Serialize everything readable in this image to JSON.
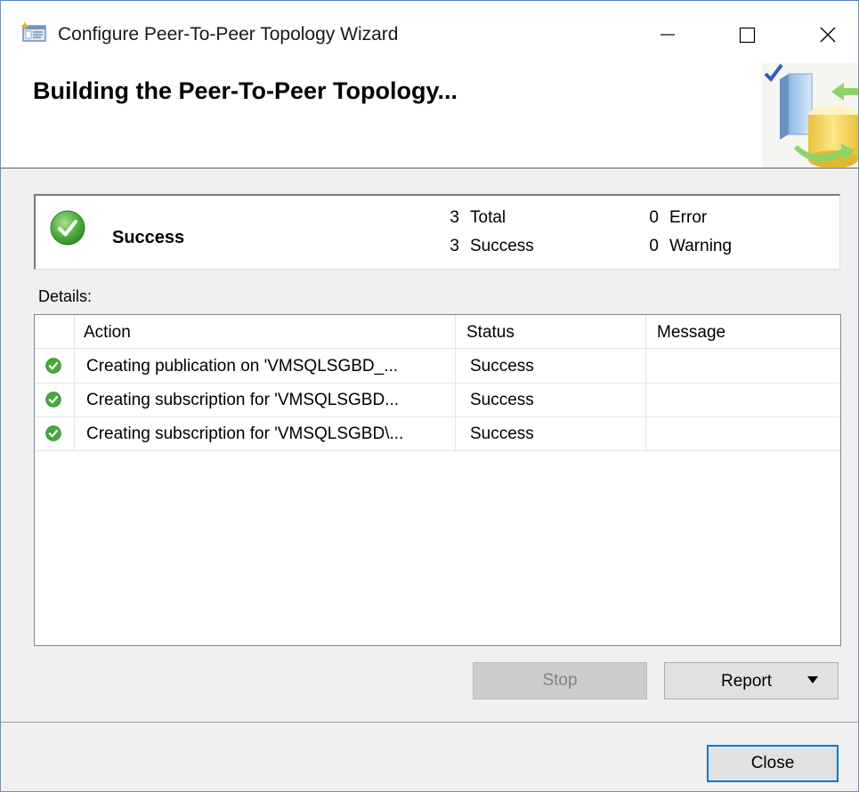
{
  "window": {
    "title": "Configure Peer-To-Peer Topology Wizard"
  },
  "header": {
    "title": "Building the Peer-To-Peer Topology..."
  },
  "summary": {
    "status": "Success",
    "total_count": "3",
    "total_label": "Total",
    "success_count": "3",
    "success_label": "Success",
    "error_count": "0",
    "error_label": "Error",
    "warning_count": "0",
    "warning_label": "Warning"
  },
  "details": {
    "label": "Details:",
    "columns": [
      "Action",
      "Status",
      "Message"
    ],
    "rows": [
      {
        "action": "Creating publication on 'VMSQLSGBD_...",
        "status": "Success",
        "message": ""
      },
      {
        "action": "Creating subscription for 'VMSQLSGBD...",
        "status": "Success",
        "message": ""
      },
      {
        "action": "Creating subscription for 'VMSQLSGBD\\...",
        "status": "Success",
        "message": ""
      }
    ]
  },
  "buttons": {
    "stop": "Stop",
    "report": "Report",
    "close": "Close"
  },
  "colors": {
    "success_green": "#3aa83a",
    "focus_blue": "#0078d7"
  }
}
